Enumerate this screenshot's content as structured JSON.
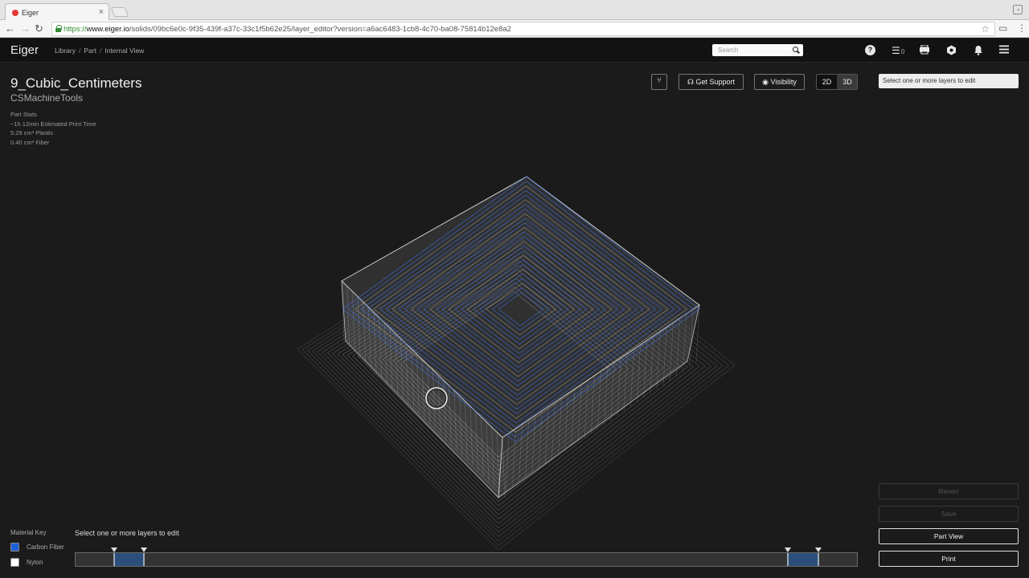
{
  "browser": {
    "tab_title": "Eiger",
    "url_scheme": "https://",
    "url_host": "www.eiger.io",
    "url_path": "/solids/09bc6e0c-9f35-439f-a37c-33c1f5b62e25/layer_editor?version=a6ac6483-1cb8-4c70-ba08-75814b12e8a2"
  },
  "header": {
    "logo": "Eiger",
    "breadcrumbs": [
      "Library",
      "Part",
      "Internal View"
    ],
    "search_placeholder": "Search",
    "queue_count": "0"
  },
  "part": {
    "name": "9_Cubic_Centimeters",
    "owner": "CSMachineTools",
    "stats_title": "Part Stats",
    "stats": [
      "~1h 12min Estimated Print Time",
      "5.29 cm³ Plastic",
      "0.40 cm³ Fiber"
    ]
  },
  "controls": {
    "version_label": "⑂",
    "support_label": "Get Support",
    "visibility_label": "Visibility",
    "mode_2d": "2D",
    "mode_3d": "3D",
    "active_mode": "3D",
    "layer_hint": "Select one or more layers to edit"
  },
  "material_key": {
    "title": "Material Key",
    "items": [
      {
        "label": "Carbon Fiber",
        "color": "#1e5fd6"
      },
      {
        "label": "Nylon",
        "color": "#ffffff"
      }
    ]
  },
  "layer_slider": {
    "hint": "Select one or more layers to edit",
    "selections": [
      {
        "start": 0.049,
        "end": 0.087
      },
      {
        "start": 0.912,
        "end": 0.951
      }
    ]
  },
  "actions": {
    "revert": "Revert",
    "save": "Save",
    "part_view": "Part View",
    "print": "Print"
  },
  "colors": {
    "background": "#1b1b1b",
    "fiber": "#3e6fe0",
    "nylon": "#d8d8d8"
  }
}
